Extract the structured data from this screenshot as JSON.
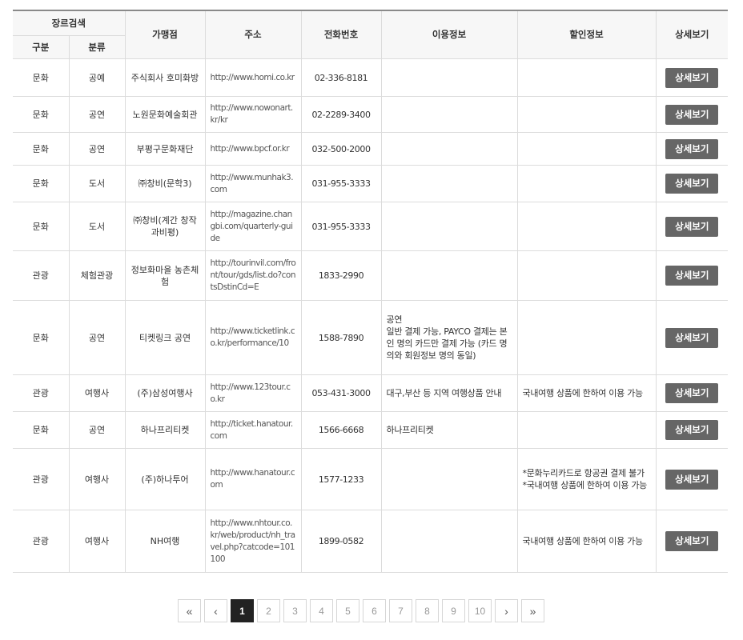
{
  "header": {
    "genre_search": "장르검색",
    "category": "구분",
    "subcategory": "분류",
    "store": "가맹점",
    "address": "주소",
    "phone": "전화번호",
    "usage": "이용정보",
    "discount": "할인정보",
    "detail": "상세보기"
  },
  "rows": [
    {
      "category": "문화",
      "sub": "공예",
      "store": "주식회사 호미화방",
      "url": "http://www.homi.co.kr",
      "phone": "02-336-8181",
      "usage": "",
      "discount": "",
      "btn": "상세보기"
    },
    {
      "category": "문화",
      "sub": "공연",
      "store": "노원문화예술회관",
      "url": "http://www.nowonart.kr/kr",
      "phone": "02-2289-3400",
      "usage": "",
      "discount": "",
      "btn": "상세보기"
    },
    {
      "category": "문화",
      "sub": "공연",
      "store": "부평구문화재단",
      "url": "http://www.bpcf.or.kr",
      "phone": "032-500-2000",
      "usage": "",
      "discount": "",
      "btn": "상세보기"
    },
    {
      "category": "문화",
      "sub": "도서",
      "store": "㈜창비(문학3)",
      "url": "http://www.munhak3.com",
      "phone": "031-955-3333",
      "usage": "",
      "discount": "",
      "btn": "상세보기"
    },
    {
      "category": "문화",
      "sub": "도서",
      "store": "㈜창비(계간 창작과비평)",
      "url": "http://magazine.changbi.com/quarterly-guide",
      "phone": "031-955-3333",
      "usage": "",
      "discount": "",
      "btn": "상세보기"
    },
    {
      "category": "관광",
      "sub": "체험관광",
      "store": "정보화마을 농촌체험",
      "url": "http://tourinvil.com/front/tour/gds/list.do?contsDstinCd=E",
      "phone": "1833-2990",
      "usage": "",
      "discount": "",
      "btn": "상세보기"
    },
    {
      "category": "문화",
      "sub": "공연",
      "store": "티켓링크 공연",
      "url": "http://www.ticketlink.co.kr/performance/10",
      "phone": "1588-7890",
      "usage": "공연\n일반 결제 가능, PAYCO 결제는 본인 명의 카드만 결제 가능 (카드 명의와 회원정보 명의 동일)",
      "discount": "",
      "btn": "상세보기"
    },
    {
      "category": "관광",
      "sub": "여행사",
      "store": "(주)삼성여행사",
      "url": "http://www.123tour.co.kr",
      "phone": "053-431-3000",
      "usage": "대구,부산 등 지역 여행상품 안내",
      "discount": "국내여행 상품에 한하여 이용 가능",
      "btn": "상세보기"
    },
    {
      "category": "문화",
      "sub": "공연",
      "store": "하나프리티켓",
      "url": "http://ticket.hanatour.com",
      "phone": "1566-6668",
      "usage": "하나프리티켓",
      "discount": "",
      "btn": "상세보기"
    },
    {
      "category": "관광",
      "sub": "여행사",
      "store": "(주)하나투어",
      "url": "http://www.hanatour.com",
      "phone": "1577-1233",
      "usage": "",
      "discount": "*문화누리카드로 항공권 결제 불가\n*국내여행 상품에 한하여 이용 가능",
      "btn": "상세보기"
    },
    {
      "category": "관광",
      "sub": "여행사",
      "store": "NH여행",
      "url": "http://www.nhtour.co.kr/web/product/nh_travel.php?catcode=101100",
      "phone": "1899-0582",
      "usage": "",
      "discount": "국내여행 상품에 한하여 이용 가능",
      "btn": "상세보기"
    }
  ],
  "pagination": {
    "first": "«",
    "prev": "‹",
    "pages": [
      "1",
      "2",
      "3",
      "4",
      "5",
      "6",
      "7",
      "8",
      "9",
      "10"
    ],
    "active": "1",
    "next": "›",
    "last": "»"
  }
}
